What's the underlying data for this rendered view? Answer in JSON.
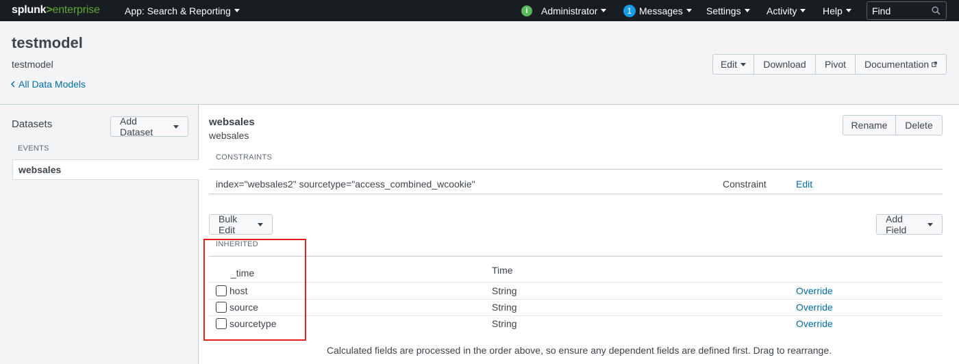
{
  "topbar": {
    "logo_prefix": "splunk",
    "logo_gt": ">",
    "logo_suffix": "enterprise",
    "app_label": "App: Search & Reporting",
    "status_glyph": "i",
    "user_label": "Administrator",
    "messages_count": "1",
    "messages_label": "Messages",
    "settings_label": "Settings",
    "activity_label": "Activity",
    "help_label": "Help",
    "find_placeholder": "Find",
    "colors": {
      "bg": "#171d21",
      "brand_green": "#65a637",
      "badge_blue": "#1a9be8",
      "status_green": "#5cb85c"
    }
  },
  "header": {
    "title": "testmodel",
    "subtitle": "testmodel",
    "back_link": "All Data Models",
    "buttons": {
      "edit": "Edit",
      "download": "Download",
      "pivot": "Pivot",
      "documentation": "Documentation"
    }
  },
  "sidebar": {
    "title": "Datasets",
    "add_dataset": "Add Dataset",
    "section": "EVENTS",
    "items": [
      {
        "label": "websales",
        "selected": true
      }
    ]
  },
  "dataset": {
    "title": "websales",
    "subtitle": "websales",
    "rename": "Rename",
    "delete": "Delete",
    "constraints_label": "CONSTRAINTS",
    "constraint": {
      "expression": "index=\"websales2\" sourcetype=\"access_combined_wcookie\"",
      "type": "Constraint",
      "action": "Edit"
    },
    "bulk_edit": "Bulk Edit",
    "add_field": "Add Field",
    "inherited_label": "INHERITED",
    "fields": [
      {
        "name": "_time",
        "type": "Time",
        "action": "",
        "checkbox": false
      },
      {
        "name": "host",
        "type": "String",
        "action": "Override",
        "checkbox": true
      },
      {
        "name": "source",
        "type": "String",
        "action": "Override",
        "checkbox": true
      },
      {
        "name": "sourcetype",
        "type": "String",
        "action": "Override",
        "checkbox": true
      }
    ],
    "note": "Calculated fields are processed in the order above, so ensure any dependent fields are defined first. Drag to rearrange."
  },
  "colors": {
    "link": "#006eaa",
    "highlight": "#e3201b"
  }
}
